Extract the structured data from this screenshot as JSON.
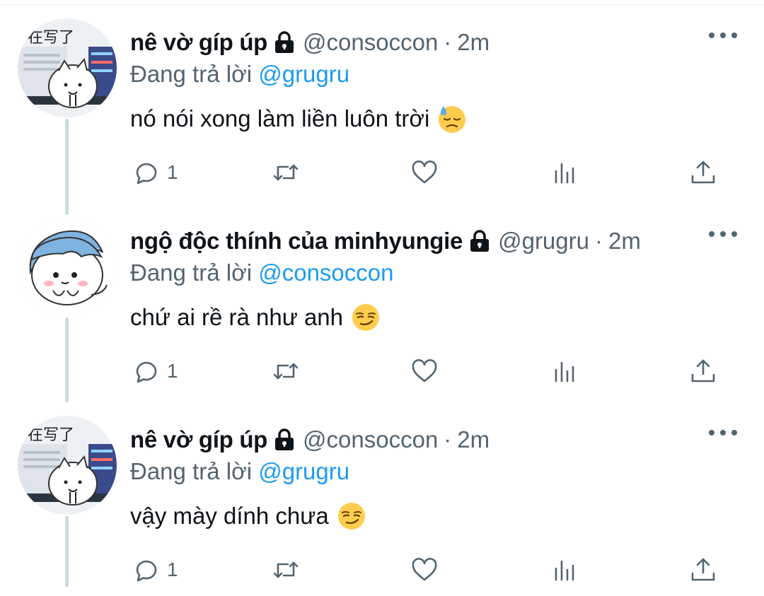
{
  "tweets": [
    {
      "name": "nê vờ gíp úp",
      "handle": "@consoccon",
      "separator": "·",
      "time": "2m",
      "reply_prefix": "Đang trả lời",
      "reply_to": "@grugru",
      "text": "nó nói xong làm liền luôn trời",
      "emoji": "downcast-sweat-emoji",
      "avatar_text": "在写了",
      "reply_count": "1"
    },
    {
      "name": "ngộ độc thính của minhyungie",
      "handle": "@grugru",
      "separator": "·",
      "time": "2m",
      "reply_prefix": "Đang trả lời",
      "reply_to": "@consoccon",
      "text": "chứ ai rề rà như anh",
      "emoji": "smirk-emoji",
      "reply_count": "1"
    },
    {
      "name": "nê vờ gíp úp",
      "handle": "@consoccon",
      "separator": "·",
      "time": "2m",
      "reply_prefix": "Đang trả lời",
      "reply_to": "@grugru",
      "text": "vậy mày dính chưa",
      "emoji": "smirk-emoji",
      "avatar_text": "在写了",
      "reply_count": "1"
    }
  ],
  "colors": {
    "text": "#0f1419",
    "secondary": "#536471",
    "link": "#1d9bf0",
    "thread_line": "#cfd9de"
  }
}
